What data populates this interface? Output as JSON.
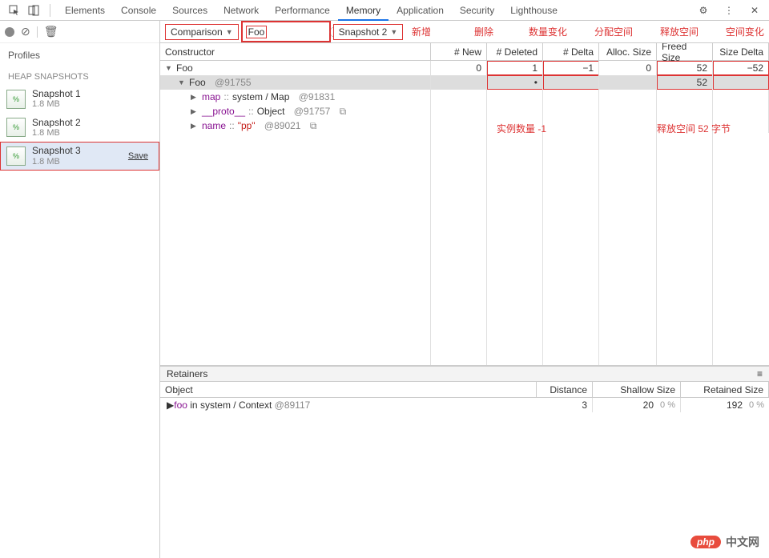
{
  "tabs": [
    "Elements",
    "Console",
    "Sources",
    "Network",
    "Performance",
    "Memory",
    "Application",
    "Security",
    "Lighthouse"
  ],
  "active_tab": "Memory",
  "sidebar": {
    "profiles_label": "Profiles",
    "heap_label": "HEAP SNAPSHOTS",
    "snapshots": [
      {
        "name": "Snapshot 1",
        "size": "1.8 MB"
      },
      {
        "name": "Snapshot 2",
        "size": "1.8 MB"
      },
      {
        "name": "Snapshot 3",
        "size": "1.8 MB"
      }
    ],
    "save_label": "Save"
  },
  "filterbar": {
    "view_mode": "Comparison",
    "filter_value": "Foo",
    "base_snapshot": "Snapshot 2"
  },
  "annotations": {
    "top": [
      "新增",
      "删除",
      "数量变化",
      "分配空间",
      "释放空间",
      "空间变化"
    ],
    "mid1": "实例数量 -1",
    "mid2": "释放空间 52 字节"
  },
  "columns": [
    "Constructor",
    "# New",
    "# Deleted",
    "# Delta",
    "Alloc. Size",
    "Freed Size",
    "Size Delta"
  ],
  "rows": [
    {
      "indent": 0,
      "toggle": "▼",
      "label": "Foo",
      "new": "0",
      "deleted": "1",
      "delta": "−1",
      "alloc": "0",
      "freed": "52",
      "sizedelta": "−52"
    },
    {
      "indent": 1,
      "toggle": "▼",
      "label": "Foo",
      "id": "@91755",
      "selected": true,
      "new": "",
      "deleted": "•",
      "delta": "",
      "alloc": "",
      "freed": "52",
      "sizedelta": ""
    },
    {
      "indent": 2,
      "toggle": "▶",
      "prop": "map",
      "sep": " :: ",
      "type": "system / Map",
      "id": "@91831"
    },
    {
      "indent": 2,
      "toggle": "▶",
      "prop": "__proto__",
      "sep": " :: ",
      "type": "Object",
      "id": "@91757",
      "ext": "⧉"
    },
    {
      "indent": 2,
      "toggle": "▶",
      "prop": "name",
      "sep": " :: ",
      "val": "\"pp\"",
      "id": "@89021",
      "ext": "⧉"
    }
  ],
  "retainers": {
    "title": "Retainers",
    "cols": [
      "Object",
      "Distance",
      "Shallow Size",
      "Retained Size"
    ],
    "row": {
      "toggle": "▶",
      "prop": "foo",
      "mid": " in ",
      "type": "system / Context",
      "id": "@89117",
      "distance": "3",
      "shallow": "20",
      "shallow_pct": "0 %",
      "retained": "192",
      "retained_pct": "0 %"
    }
  },
  "watermark": {
    "badge": "php",
    "text": "中文网"
  }
}
